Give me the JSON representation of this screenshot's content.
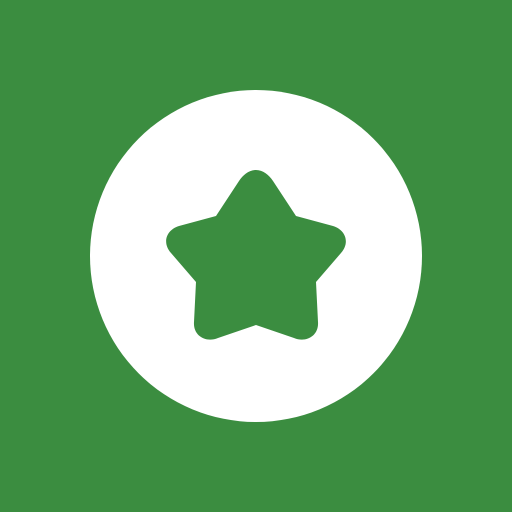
{
  "icon": {
    "name": "star-icon",
    "background_color": "#3b8d40",
    "circle_color": "#ffffff",
    "star_color": "#3b8d40"
  }
}
